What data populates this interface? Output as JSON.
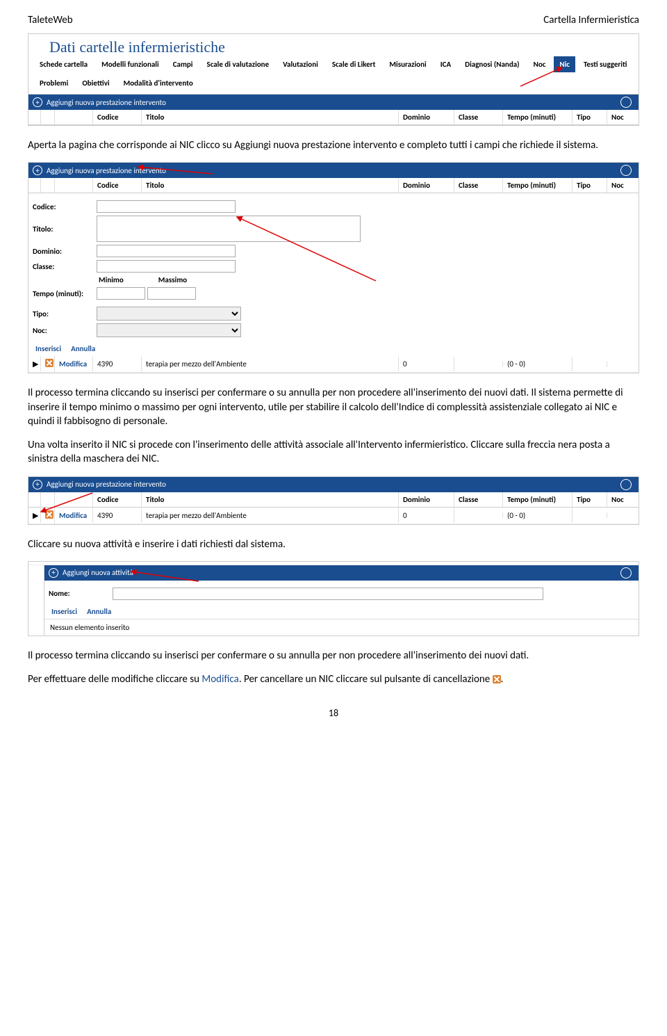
{
  "header": {
    "left": "TaleteWeb",
    "right": "Cartella Infermieristica"
  },
  "shot1": {
    "title": "Dati cartelle infermieristiche",
    "tabs": [
      "Schede cartella",
      "Modelli funzionali",
      "Campi",
      "Scale di valutazione",
      "Valutazioni",
      "Scale di Likert",
      "Misurazioni",
      "ICA",
      "Diagnosi (Nanda)",
      "Noc",
      "Nic",
      "Testi suggeriti",
      "Problemi",
      "Obiettivi",
      "Modalità d'intervento"
    ],
    "activeTab": "Nic",
    "add": "Aggiungi nuova prestazione intervento",
    "cols": {
      "cod": "Codice",
      "tit": "Titolo",
      "dom": "Dominio",
      "cla": "Classe",
      "tmp": "Tempo (minuti)",
      "tip": "Tipo",
      "noc": "Noc"
    }
  },
  "para1": "Aperta la pagina che corrisponde ai NIC clicco su Aggiungi nuova prestazione intervento e completo tutti i campi che richiede il sistema.",
  "shot2": {
    "add": "Aggiungi nuova prestazione intervento",
    "cols": {
      "cod": "Codice",
      "tit": "Titolo",
      "dom": "Dominio",
      "cla": "Classe",
      "tmp": "Tempo (minuti)",
      "tip": "Tipo",
      "noc": "Noc"
    },
    "form": {
      "codice": "Codice:",
      "titolo": "Titolo:",
      "dominio": "Dominio:",
      "classe": "Classe:",
      "tempo": "Tempo (minuti):",
      "min": "Minimo",
      "max": "Massimo",
      "tipo": "Tipo:",
      "noc": "Noc:",
      "ins": "Inserisci",
      "ann": "Annulla"
    },
    "row": {
      "mod": "Modifica",
      "cod": "4390",
      "tit": "terapia per mezzo dell'Ambiente",
      "dom": "0",
      "tmp": "(0 - 0)"
    }
  },
  "para2a": "Il processo termina cliccando su inserisci per confermare o su annulla per non procedere all'inserimento dei nuovi dati. Il sistema permette di inserire il tempo minimo o massimo per ogni intervento, utile per stabilire il calcolo dell'Indice di complessità assistenziale collegato ai NIC e quindi il fabbisogno di personale.",
  "para2b": "Una volta inserito il NIC si procede con l'inserimento delle attività associale all'Intervento infermieristico. Cliccare sulla freccia nera posta a sinistra della maschera dei NIC.",
  "shot3": {
    "add": "Aggiungi nuova prestazione intervento",
    "cols": {
      "cod": "Codice",
      "tit": "Titolo",
      "dom": "Dominio",
      "cla": "Classe",
      "tmp": "Tempo (minuti)",
      "tip": "Tipo",
      "noc": "Noc"
    },
    "row": {
      "mod": "Modifica",
      "cod": "4390",
      "tit": "terapia per mezzo dell'Ambiente",
      "dom": "0",
      "tmp": "(0 - 0)"
    }
  },
  "para3": "Cliccare su nuova attività e inserire i dati richiesti dal sistema.",
  "shot4": {
    "add": "Aggiungi nuova attività",
    "nome": "Nome:",
    "ins": "Inserisci",
    "ann": "Annulla",
    "empty": "Nessun elemento inserito"
  },
  "para4": "Il processo termina cliccando su inserisci per confermare o su annulla per non procedere all'inserimento dei nuovi dati.",
  "para5a": "Per effettuare delle modifiche cliccare su ",
  "para5b": "Modifica",
  "para5c": ". Per cancellare un NIC cliccare sul pulsante di cancellazione ",
  "para5d": ".",
  "pageNum": "18"
}
